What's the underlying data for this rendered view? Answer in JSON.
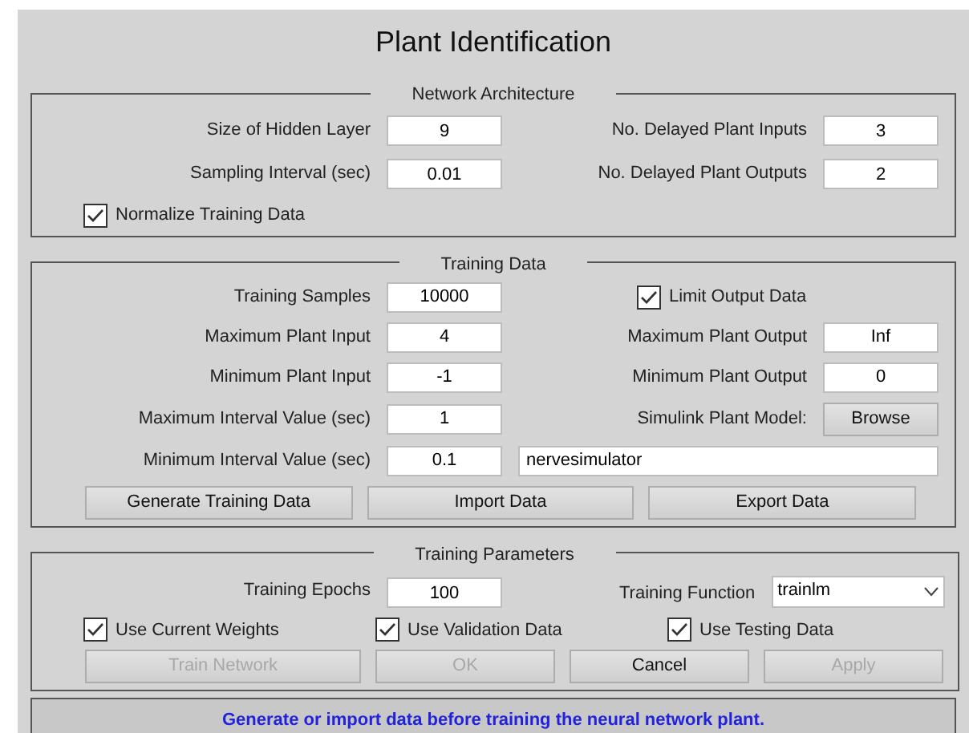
{
  "title": "Plant Identification",
  "network_architecture": {
    "legend": "Network Architecture",
    "fields": [
      {
        "label": "Size of Hidden Layer",
        "value": "9"
      },
      {
        "label": "No. Delayed Plant Inputs",
        "value": "3"
      },
      {
        "label": "Sampling Interval (sec)",
        "value": "0.01"
      },
      {
        "label": "No. Delayed Plant Outputs",
        "value": "2"
      }
    ],
    "normalize": {
      "label": "Normalize Training Data",
      "checked": true
    }
  },
  "training_data": {
    "legend": "Training Data",
    "training_samples": {
      "label": "Training Samples",
      "value": "10000"
    },
    "limit_output": {
      "label": "Limit Output Data",
      "checked": true
    },
    "fields": [
      {
        "label": "Maximum Plant Input",
        "value": "4"
      },
      {
        "label": "Maximum Plant Output",
        "value": "Inf"
      },
      {
        "label": "Minimum Plant Input",
        "value": "-1"
      },
      {
        "label": "Minimum Plant Output",
        "value": "0"
      }
    ],
    "max_interval": {
      "label": "Maximum Interval Value (sec)",
      "value": "1"
    },
    "simulink_label": "Simulink Plant Model:",
    "browse": "Browse",
    "min_interval": {
      "label": "Minimum Interval Value (sec)",
      "value": "0.1"
    },
    "model_name": "nervesimulator",
    "buttons": [
      "Generate Training Data",
      "Import Data",
      "Export Data"
    ]
  },
  "training_parameters": {
    "legend": "Training Parameters",
    "epochs": {
      "label": "Training Epochs",
      "value": "100"
    },
    "function": {
      "label": "Training Function",
      "value": "trainlm"
    },
    "checkboxes": [
      {
        "label": "Use Current Weights",
        "checked": true
      },
      {
        "label": "Use Validation Data",
        "checked": true
      },
      {
        "label": "Use Testing Data",
        "checked": true
      }
    ],
    "buttons": [
      {
        "label": "Train Network",
        "disabled": true
      },
      {
        "label": "OK",
        "disabled": true
      },
      {
        "label": "Cancel",
        "disabled": false
      },
      {
        "label": "Apply",
        "disabled": true
      }
    ]
  },
  "status": "Generate or import data before training the neural network plant."
}
